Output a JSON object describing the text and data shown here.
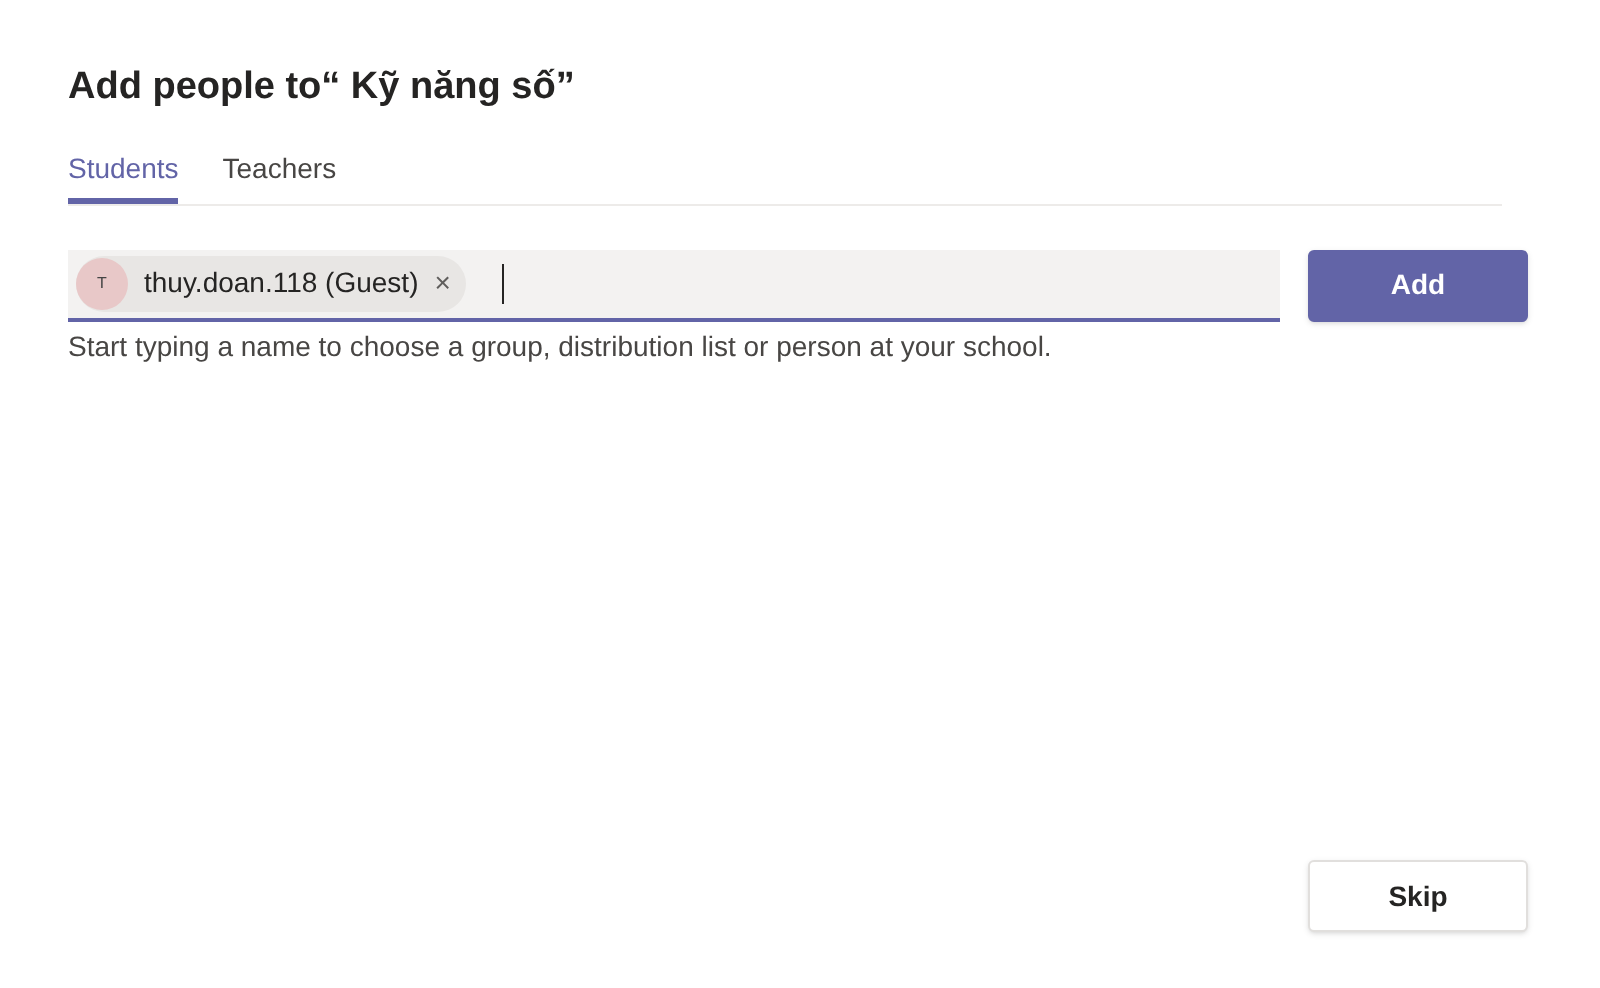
{
  "dialog": {
    "title": "Add people to“ Kỹ năng số”"
  },
  "tabs": [
    {
      "label": "Students",
      "selected": true
    },
    {
      "label": "Teachers",
      "selected": false
    }
  ],
  "people_field": {
    "chips": [
      {
        "initial": "T",
        "name": "thuy.doan.118 (Guest)",
        "remove": "×"
      }
    ]
  },
  "add_button": "Add",
  "hint": "Start typing a name to choose a group, distribution list or person at your school.",
  "skip_button": "Skip"
}
